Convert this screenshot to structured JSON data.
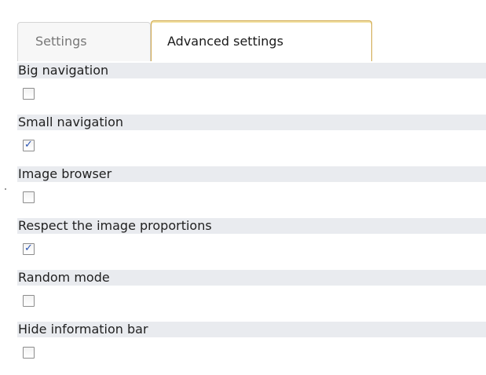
{
  "tabs": [
    {
      "label": "Settings",
      "active": false
    },
    {
      "label": "Advanced settings",
      "active": true
    }
  ],
  "options": [
    {
      "label": "Big navigation",
      "checked": false
    },
    {
      "label": "Small navigation",
      "checked": true
    },
    {
      "label": "Image browser",
      "checked": false
    },
    {
      "label": "Respect the image proportions",
      "checked": true
    },
    {
      "label": "Random mode",
      "checked": false
    },
    {
      "label": "Hide information bar",
      "checked": false
    }
  ],
  "colors": {
    "label_bg": "#e9ebef",
    "active_tab_border": "#cfa64a",
    "checkmark": "#2b55b3"
  }
}
